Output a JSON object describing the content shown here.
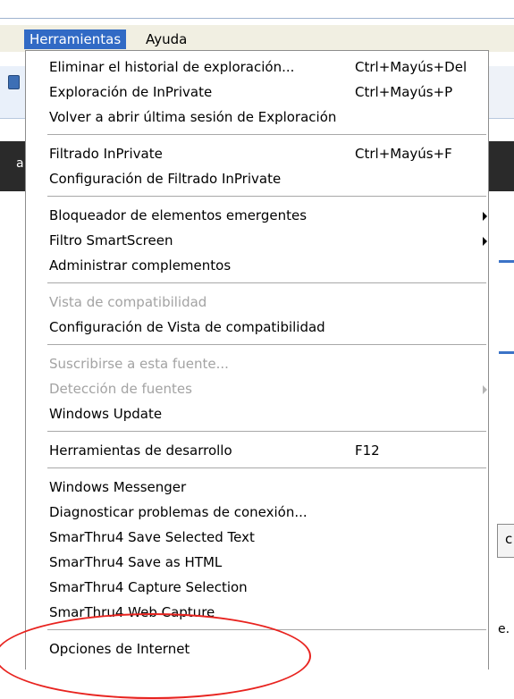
{
  "menubar": {
    "items": [
      {
        "label": "Herramientas",
        "active": true
      },
      {
        "label": "Ayuda",
        "active": false
      }
    ]
  },
  "background": {
    "left_glyph": "a",
    "right_box_text": "c",
    "right_text": "e."
  },
  "menu": {
    "groups": [
      [
        {
          "label": "Eliminar el historial de exploración...",
          "shortcut": "Ctrl+Mayús+Del",
          "enabled": true
        },
        {
          "label": "Exploración de InPrivate",
          "shortcut": "Ctrl+Mayús+P",
          "enabled": true
        },
        {
          "label": "Volver a abrir última sesión de Exploración",
          "enabled": true
        }
      ],
      [
        {
          "label": "Filtrado InPrivate",
          "shortcut": "Ctrl+Mayús+F",
          "enabled": true
        },
        {
          "label": "Configuración de Filtrado InPrivate",
          "enabled": true
        }
      ],
      [
        {
          "label": "Bloqueador de elementos emergentes",
          "submenu": true,
          "enabled": true
        },
        {
          "label": "Filtro SmartScreen",
          "submenu": true,
          "enabled": true
        },
        {
          "label": "Administrar complementos",
          "enabled": true
        }
      ],
      [
        {
          "label": "Vista de compatibilidad",
          "enabled": false
        },
        {
          "label": "Configuración de Vista de compatibilidad",
          "enabled": true
        }
      ],
      [
        {
          "label": "Suscribirse a esta fuente...",
          "enabled": false
        },
        {
          "label": "Detección de fuentes",
          "submenu": true,
          "enabled": false
        },
        {
          "label": "Windows Update",
          "enabled": true
        }
      ],
      [
        {
          "label": "Herramientas de desarrollo",
          "shortcut": "F12",
          "enabled": true
        }
      ],
      [
        {
          "label": "Windows Messenger",
          "enabled": true
        },
        {
          "label": "Diagnosticar problemas de conexión...",
          "enabled": true
        },
        {
          "label": "SmarThru4 Save Selected Text",
          "enabled": true
        },
        {
          "label": "SmarThru4 Save as HTML",
          "enabled": true
        },
        {
          "label": "SmarThru4 Capture Selection",
          "enabled": true
        },
        {
          "label": "SmarThru4 Web Capture",
          "enabled": true
        }
      ],
      [
        {
          "label": "Opciones de Internet",
          "enabled": true,
          "annotated": true
        }
      ]
    ]
  },
  "colors": {
    "menubar_active_bg": "#316ac5",
    "disabled_text": "#a3a3a3",
    "annotation": "#e8231f"
  }
}
